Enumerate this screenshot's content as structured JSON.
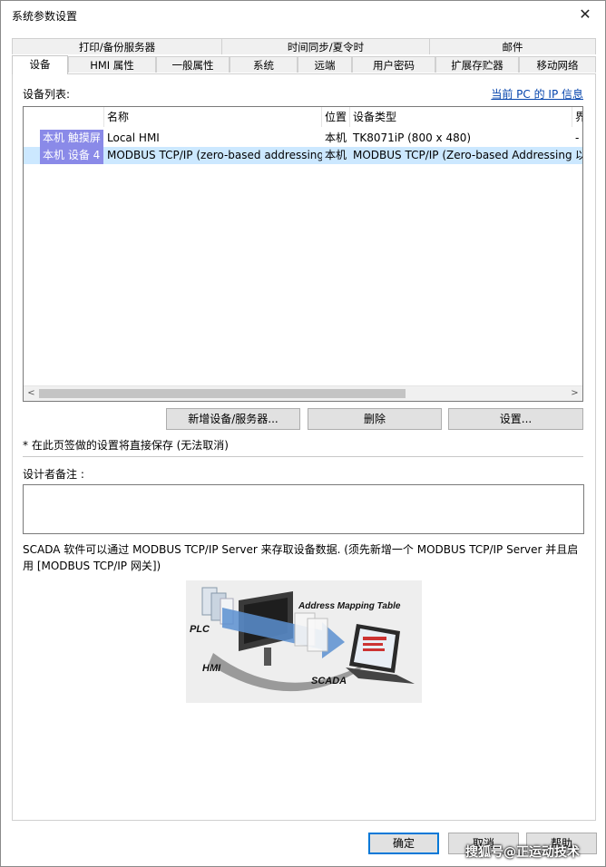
{
  "window": {
    "title": "系统参数设置",
    "close_glyph": "✕"
  },
  "tabs_row1": [
    "打印/备份服务器",
    "时间同步/夏令时",
    "邮件"
  ],
  "tabs_row2": [
    "设备",
    "HMI 属性",
    "一般属性",
    "系统",
    "远端",
    "用户密码",
    "扩展存贮器",
    "移动网络"
  ],
  "active_tab": "设备",
  "devices": {
    "list_label": "设备列表:",
    "pc_ip_link": "当前 PC 的 IP 信息",
    "columns": [
      "名称",
      "位置",
      "设备类型",
      "界"
    ],
    "rows": [
      {
        "device": "本机 触摸屏",
        "name": "Local HMI",
        "location": "本机",
        "type": "TK8071iP (800 x 480)",
        "extra": "-"
      },
      {
        "device": "本机 设备 4",
        "name": "MODBUS TCP/IP (zero-based addressing)",
        "location": "本机",
        "type": "MODBUS TCP/IP (Zero-based Addressing)",
        "extra": "以"
      }
    ],
    "selected_row": 1,
    "scroll_left": "<",
    "scroll_right": ">"
  },
  "buttons": {
    "add": "新增设备/服务器...",
    "delete": "删除",
    "settings": "设置..."
  },
  "save_note": "* 在此页签做的设置将直接保存 (无法取消)",
  "designer_note_label": "设计者备注 :",
  "scada_info": "SCADA 软件可以通过 MODBUS TCP/IP Server 来存取设备数据. (须先新增一个 MODBUS TCP/IP Server 并且启用 [MODBUS TCP/IP 网关])",
  "diagram": {
    "plc": "PLC",
    "hmi": "HMI",
    "scada": "SCADA",
    "table": "Address Mapping Table"
  },
  "footer": {
    "ok": "确定",
    "cancel": "取消",
    "help": "帮助"
  },
  "watermark": "搜狐号@正运动技术",
  "colors": {
    "device_cell": "#8a8ae8",
    "selection": "#cce8ff",
    "link": "#0645ad",
    "default_button_border": "#0078d7"
  }
}
